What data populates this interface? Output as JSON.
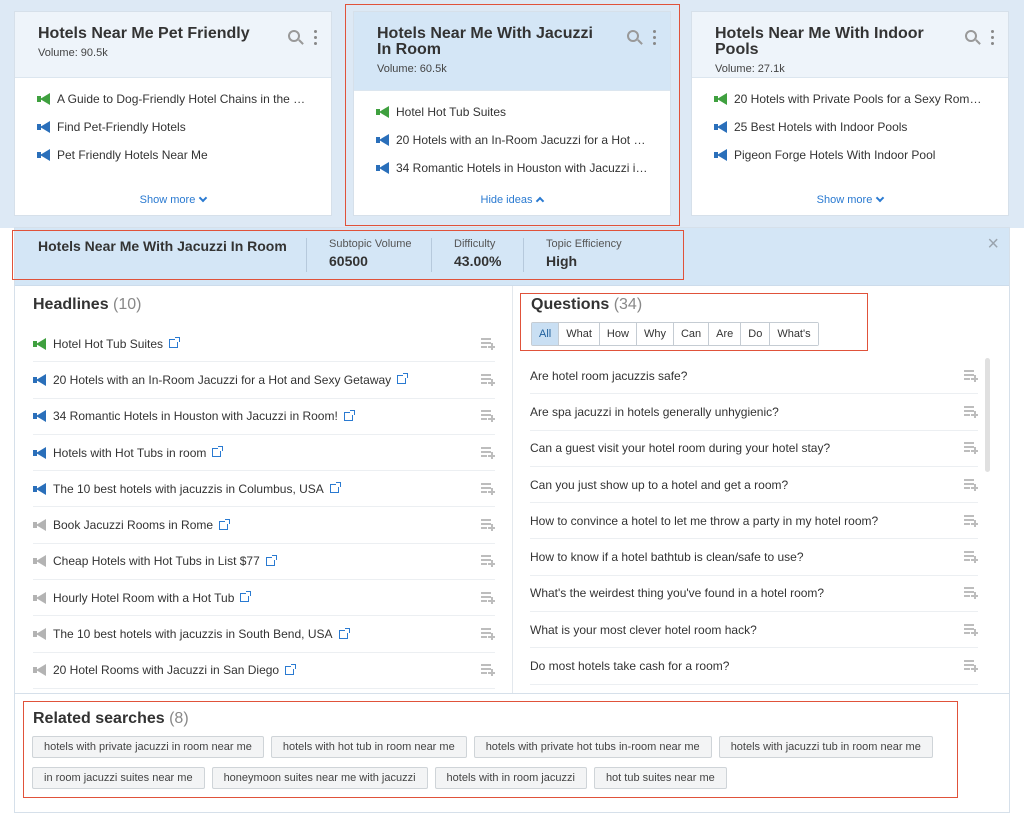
{
  "cards": [
    {
      "title": "Hotels Near Me Pet Friendly",
      "volume": "Volume: 90.5k",
      "items": [
        {
          "icon": "green-megaphone-icon",
          "text": "A Guide to Dog-Friendly Hotel Chains in the U..."
        },
        {
          "icon": "blue-megaphone-icon",
          "text": "Find Pet-Friendly Hotels"
        },
        {
          "icon": "blue-megaphone-icon",
          "text": "Pet Friendly Hotels Near Me"
        }
      ],
      "footer": "Show more"
    },
    {
      "title": "Hotels Near Me With Jacuzzi In Room",
      "volume": "Volume: 60.5k",
      "items": [
        {
          "icon": "green-megaphone-icon",
          "text": "Hotel Hot Tub Suites"
        },
        {
          "icon": "blue-megaphone-icon",
          "text": "20 Hotels with an In-Room Jacuzzi for a Hot a..."
        },
        {
          "icon": "blue-megaphone-icon",
          "text": "34 Romantic Hotels in Houston with Jacuzzi in..."
        }
      ],
      "footer": "Hide ideas"
    },
    {
      "title": "Hotels Near Me With Indoor Pools",
      "volume": "Volume: 27.1k",
      "items": [
        {
          "icon": "green-megaphone-icon",
          "text": "20 Hotels with Private Pools for a Sexy Roman..."
        },
        {
          "icon": "blue-megaphone-icon",
          "text": "25 Best Hotels with Indoor Pools"
        },
        {
          "icon": "blue-megaphone-icon",
          "text": "Pigeon Forge Hotels With Indoor Pool"
        }
      ],
      "footer": "Show more"
    }
  ],
  "detail": {
    "title": "Hotels Near Me With Jacuzzi In Room",
    "metrics": [
      {
        "label": "Subtopic Volume",
        "value": "60500"
      },
      {
        "label": "Difficulty",
        "value": "43.00%"
      },
      {
        "label": "Topic Efficiency",
        "value": "High"
      }
    ],
    "close": "×"
  },
  "headlines": {
    "title": "Headlines",
    "count": "(10)",
    "items": [
      {
        "icon": "green",
        "text": "Hotel Hot Tub Suites"
      },
      {
        "icon": "blue",
        "text": "20 Hotels with an In-Room Jacuzzi for a Hot and Sexy Getaway"
      },
      {
        "icon": "blue",
        "text": "34 Romantic Hotels in Houston with Jacuzzi in Room!"
      },
      {
        "icon": "blue",
        "text": "Hotels with Hot Tubs in room"
      },
      {
        "icon": "blue",
        "text": "The 10 best hotels with jacuzzis in Columbus, USA"
      },
      {
        "icon": "gray",
        "text": "Book Jacuzzi Rooms in Rome"
      },
      {
        "icon": "gray",
        "text": "Cheap Hotels with Hot Tubs in List $77"
      },
      {
        "icon": "gray",
        "text": "Hourly Hotel Room with a Hot Tub"
      },
      {
        "icon": "gray",
        "text": "The 10 best hotels with jacuzzis in South Bend, USA"
      },
      {
        "icon": "gray",
        "text": "20 Hotel Rooms with Jacuzzi in San Diego"
      }
    ]
  },
  "questions": {
    "title": "Questions",
    "count": "(34)",
    "filters": [
      "All",
      "What",
      "How",
      "Why",
      "Can",
      "Are",
      "Do",
      "What's"
    ],
    "active_filter": "All",
    "items": [
      "Are hotel room jacuzzis safe?",
      "Are spa jacuzzi in hotels generally unhygienic?",
      "Can a guest visit your hotel room during your hotel stay?",
      "Can you just show up to a hotel and get a room?",
      "How to convince a hotel to let me throw a party in my hotel room?",
      "How to know if a hotel bathtub is clean/safe to use?",
      "What's the weirdest thing you've found in a hotel room?",
      "What is your most clever hotel room hack?",
      "Do most hotels take cash for a room?"
    ]
  },
  "related": {
    "title": "Related searches",
    "count": "(8)",
    "items": [
      "hotels with private jacuzzi in room near me",
      "hotels with hot tub in room near me",
      "hotels with private hot tubs in-room near me",
      "hotels with jacuzzi tub in room near me",
      "in room jacuzzi suites near me",
      "honeymoon suites near me with jacuzzi",
      "hotels with in room jacuzzi",
      "hot tub suites near me"
    ]
  },
  "colors": {
    "accent": "#2a7ad1",
    "active_card": "#d4e6f6",
    "highlight_border": "#e0523a",
    "megaphone_green": "#3fa03f",
    "megaphone_blue": "#2a6fba",
    "megaphone_gray": "#b3b3b3"
  }
}
